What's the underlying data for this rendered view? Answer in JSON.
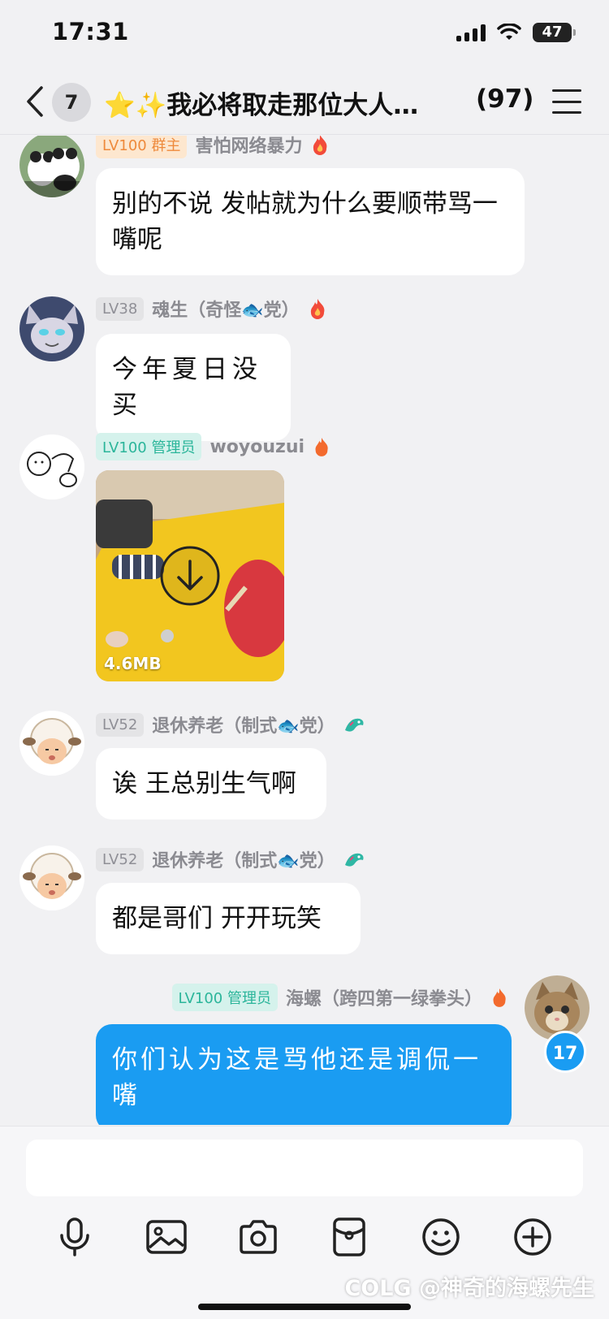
{
  "status_bar": {
    "time": "17:31",
    "battery": "47"
  },
  "header": {
    "unread": "7",
    "title": "⭐✨我必将取走那位大人…",
    "member_count": "(97)"
  },
  "messages": [
    {
      "level": "LV100",
      "role": "群主",
      "name": "害怕网络暴力",
      "text": "别的不说  发帖就为什么要顺带骂一嘴呢"
    },
    {
      "level": "LV38",
      "role": "",
      "name": "魂生（奇怪🐟党）",
      "text": "今年夏日没买"
    },
    {
      "level": "LV100",
      "role": "管理员",
      "name": "woyouzui",
      "video_size": "4.6MB"
    },
    {
      "level": "LV52",
      "role": "",
      "name": "退休养老（制式🐟党）",
      "text": "诶 王总别生气啊"
    },
    {
      "level": "LV52",
      "role": "",
      "name": "退休养老（制式🐟党）",
      "text": "都是哥们 开开玩笑"
    },
    {
      "level": "LV100",
      "role": "管理员",
      "name": "海螺（跨四第一绿拳头）",
      "text": "你们认为这是骂他还是调侃一嘴",
      "unread_count": "17"
    }
  ],
  "input": {
    "placeholder": ""
  },
  "watermark": "COLG @神奇的海螺先生",
  "colors": {
    "accent": "#1a9cf2",
    "admin": "#2bb59a",
    "owner": "#ee8a3c"
  }
}
